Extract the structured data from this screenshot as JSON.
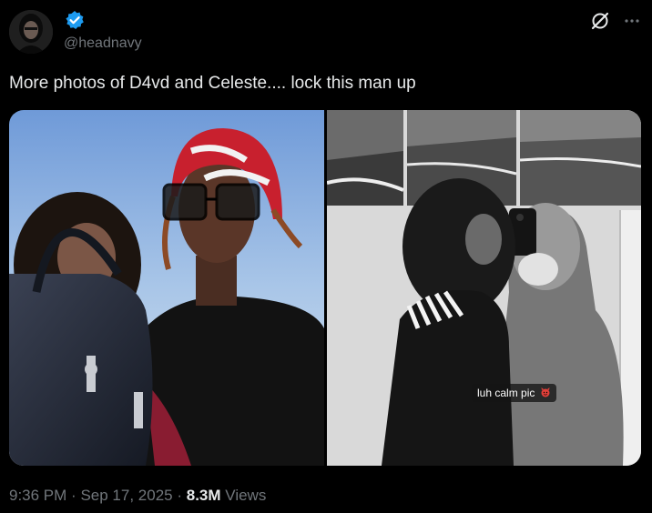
{
  "tweet": {
    "handle": "@headnavy",
    "text": "More photos of D4vd and Celeste.... lock this man up",
    "time": "9:36 PM",
    "separator": "·",
    "date": "Sep 17, 2025",
    "views_count": "8.3M",
    "views_label": "Views"
  },
  "media": {
    "photo2_caption": "luh calm pic",
    "caption_emoji": "devil-emoji"
  },
  "icons": {
    "verified": "verified-badge-icon",
    "grok": "grok-icon",
    "more": "more-options-icon"
  },
  "colors": {
    "background": "#000000",
    "text": "#e7e9ea",
    "muted": "#71767b",
    "verified": "#1d9bf0"
  }
}
